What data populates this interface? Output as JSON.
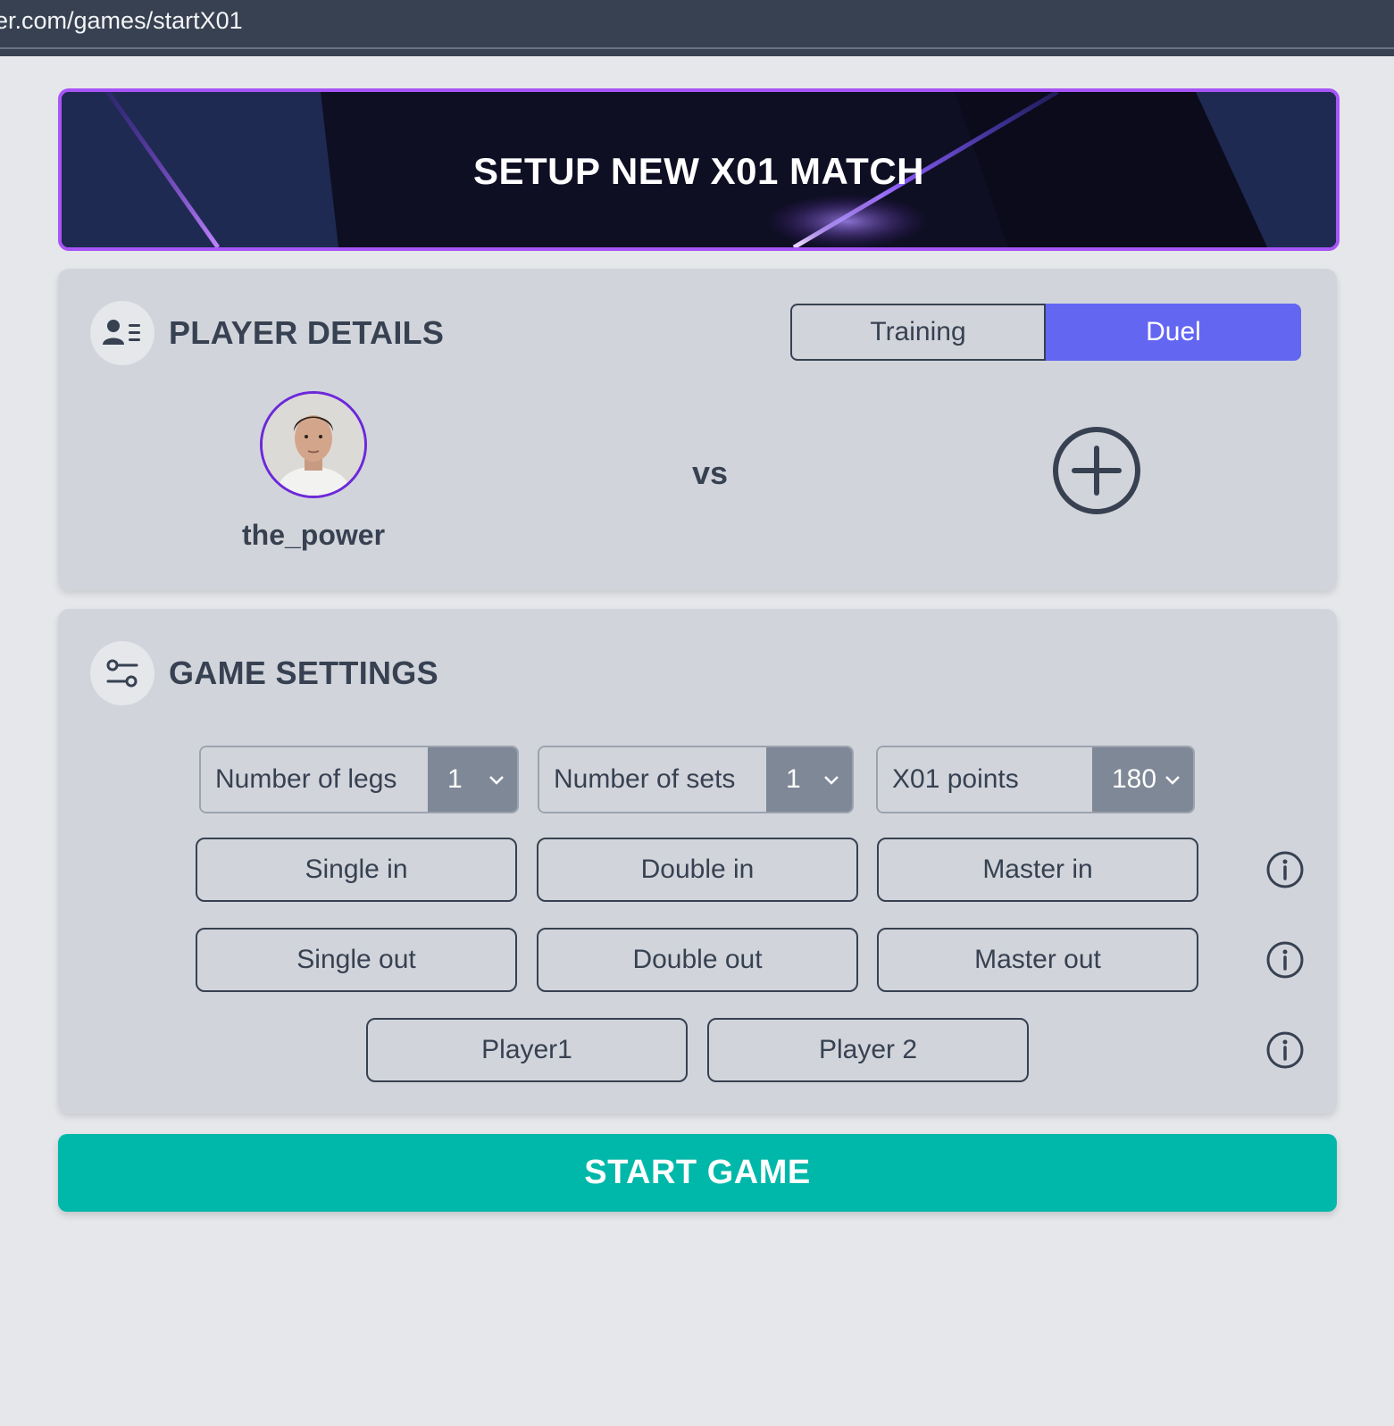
{
  "browser": {
    "url": "er.com/games/startX01"
  },
  "banner": {
    "title": "SETUP NEW X01 MATCH"
  },
  "player_details": {
    "title": "PLAYER DETAILS",
    "modes": [
      "Training",
      "Duel"
    ],
    "selected_mode": "Duel",
    "player1": {
      "name": "the_power"
    },
    "vs_label": "vs"
  },
  "game_settings": {
    "title": "GAME SETTINGS",
    "legs": {
      "label": "Number of legs",
      "value": "1"
    },
    "sets": {
      "label": "Number of sets",
      "value": "1"
    },
    "points": {
      "label": "X01 points",
      "value": "180"
    },
    "in_options": [
      "Single in",
      "Double in",
      "Master in"
    ],
    "out_options": [
      "Single out",
      "Double out",
      "Master out"
    ],
    "starter_options": [
      "Player1",
      "Player 2"
    ]
  },
  "start_button": "START GAME",
  "colors": {
    "accent": "#6366f1",
    "start": "#00b8a9",
    "banner_border": "#a855f7"
  }
}
